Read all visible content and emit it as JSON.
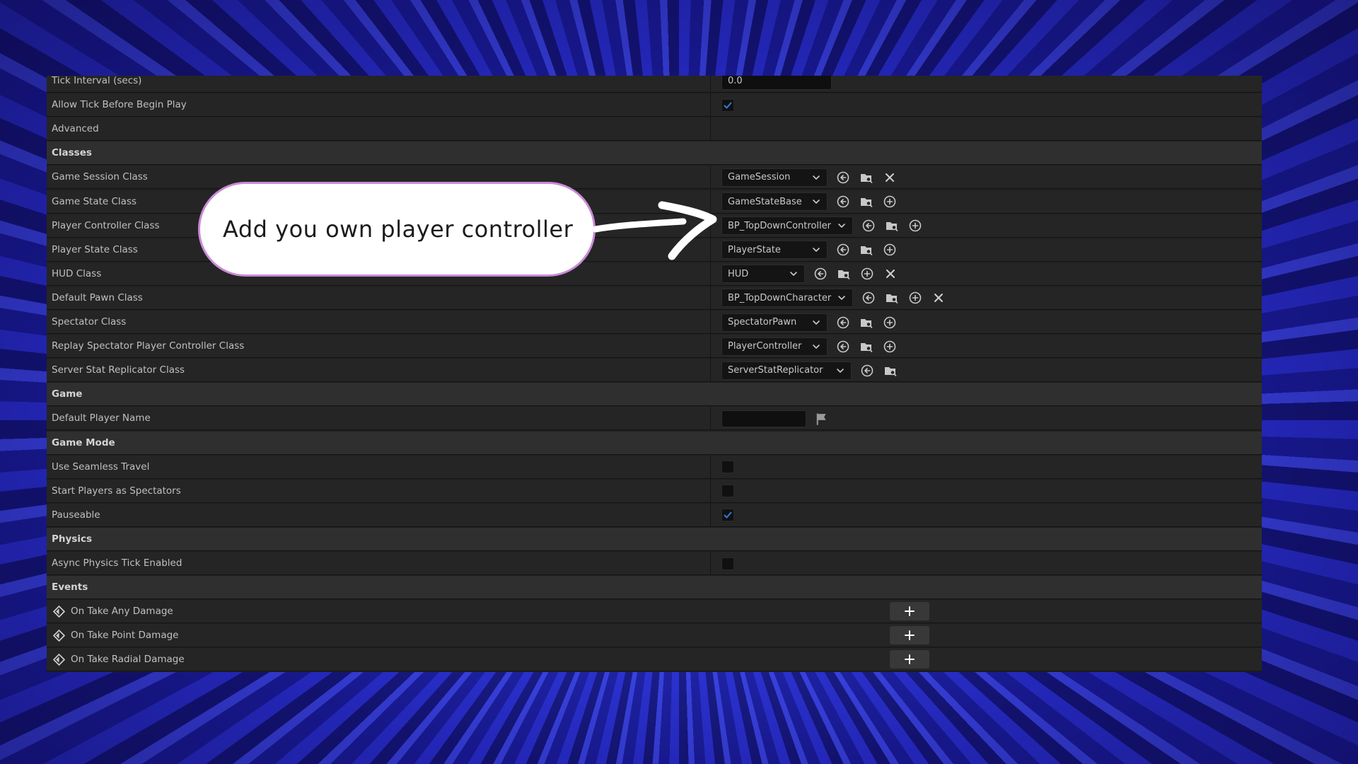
{
  "rows": [
    {
      "kind": "prop",
      "label": "Tick Interval (secs)",
      "control": "text",
      "value": "0.0"
    },
    {
      "kind": "prop",
      "label": "Allow Tick Before Begin Play",
      "control": "check",
      "checked": true
    },
    {
      "kind": "prop",
      "label": "Advanced",
      "control": "none"
    },
    {
      "kind": "cat",
      "label": "Classes"
    },
    {
      "kind": "prop",
      "label": "Game Session Class",
      "control": "class",
      "value": "GameSession",
      "icons": [
        "reset-arrow-icon",
        "browse-folder-icon",
        "clear-x-icon"
      ]
    },
    {
      "kind": "prop",
      "label": "Game State Class",
      "control": "class",
      "value": "GameStateBase",
      "icons": [
        "reset-arrow-icon",
        "browse-folder-icon",
        "add-circle-icon"
      ]
    },
    {
      "kind": "prop",
      "label": "Player Controller Class",
      "control": "class",
      "value": "BP_TopDownController",
      "icons": [
        "reset-arrow-icon",
        "browse-folder-icon",
        "add-circle-icon"
      ]
    },
    {
      "kind": "prop",
      "label": "Player State Class",
      "control": "class",
      "value": "PlayerState",
      "icons": [
        "reset-arrow-icon",
        "browse-folder-icon",
        "add-circle-icon"
      ]
    },
    {
      "kind": "prop",
      "label": "HUD Class",
      "control": "class",
      "value": "HUD",
      "icons": [
        "reset-arrow-icon",
        "browse-folder-icon",
        "add-circle-icon",
        "clear-x-icon"
      ]
    },
    {
      "kind": "prop",
      "label": "Default Pawn Class",
      "control": "class",
      "value": "BP_TopDownCharacter",
      "icons": [
        "reset-arrow-icon",
        "browse-folder-icon",
        "add-circle-icon",
        "clear-x-icon"
      ]
    },
    {
      "kind": "prop",
      "label": "Spectator Class",
      "control": "class",
      "value": "SpectatorPawn",
      "icons": [
        "reset-arrow-icon",
        "browse-folder-icon",
        "add-circle-icon"
      ]
    },
    {
      "kind": "prop",
      "label": "Replay Spectator Player Controller Class",
      "control": "class",
      "value": "PlayerController",
      "icons": [
        "reset-arrow-icon",
        "browse-folder-icon",
        "add-circle-icon"
      ]
    },
    {
      "kind": "prop",
      "label": "Server Stat Replicator Class",
      "control": "class",
      "value": "ServerStatReplicator",
      "icons": [
        "reset-arrow-icon",
        "browse-folder-icon"
      ]
    },
    {
      "kind": "cat",
      "label": "Game"
    },
    {
      "kind": "prop",
      "label": "Default Player Name",
      "control": "text",
      "value": "",
      "flag": true
    },
    {
      "kind": "cat",
      "label": "Game Mode"
    },
    {
      "kind": "prop",
      "label": "Use Seamless Travel",
      "control": "check",
      "checked": false
    },
    {
      "kind": "prop",
      "label": "Start Players as Spectators",
      "control": "check",
      "checked": false
    },
    {
      "kind": "prop",
      "label": "Pauseable",
      "control": "check",
      "checked": true
    },
    {
      "kind": "cat",
      "label": "Physics"
    },
    {
      "kind": "prop",
      "label": "Async Physics Tick Enabled",
      "control": "check",
      "checked": false
    },
    {
      "kind": "cat",
      "label": "Events"
    },
    {
      "kind": "event",
      "label": "On Take Any Damage"
    },
    {
      "kind": "event",
      "label": "On Take Point Damage"
    },
    {
      "kind": "event",
      "label": "On Take Radial Damage"
    }
  ],
  "callout": {
    "text": "Add you own player controller"
  },
  "colors": {
    "accent_check": "#2d7fd6",
    "panel": "#1f1f1f",
    "category": "#2f2f2f",
    "row": "#252525"
  }
}
